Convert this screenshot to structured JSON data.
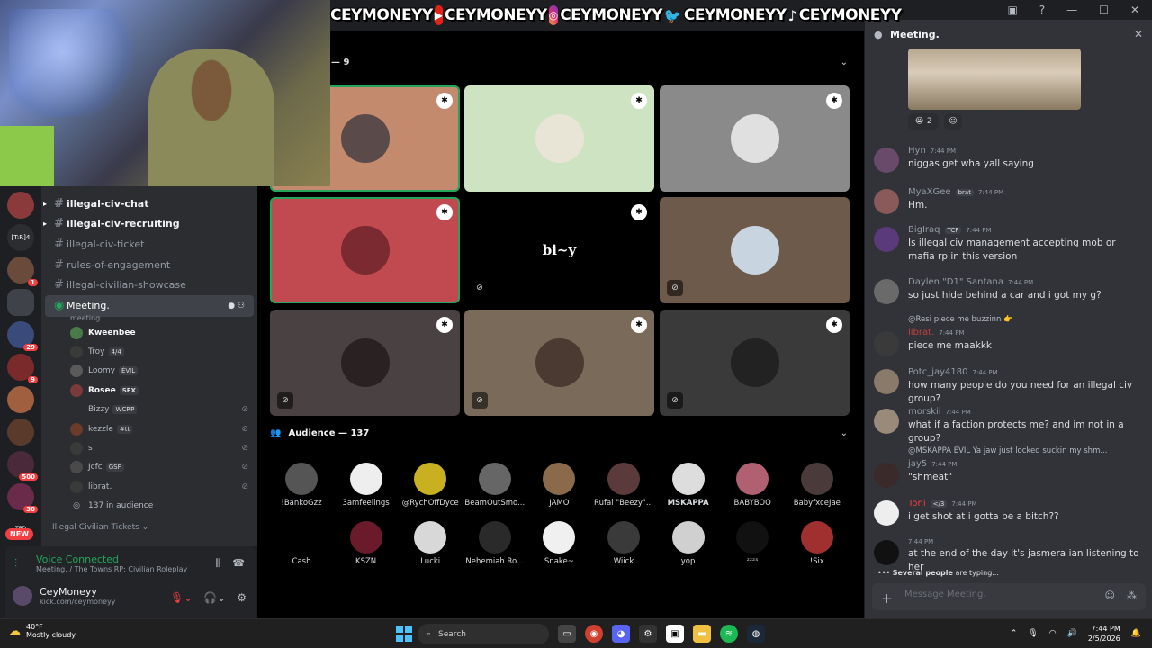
{
  "banner": {
    "handles": [
      "CEYMONEYY",
      "CEYMONEYY",
      "CEYMONEYY",
      "CEYMONEYY",
      "CEYMONEYY"
    ]
  },
  "sidebar": {
    "channels": [
      {
        "label": "illegal-civ-chat",
        "state": "unread"
      },
      {
        "label": "illegal-civ-recruiting",
        "state": "unread"
      },
      {
        "label": "illegal-civ-ticket",
        "state": "normal"
      },
      {
        "label": "rules-of-engagement",
        "state": "normal"
      },
      {
        "label": "illegal-civilian-showcase",
        "state": "normal"
      }
    ],
    "meeting": {
      "label": "Meeting.",
      "sub": "meeting"
    },
    "voice_users": [
      {
        "name": "Kweenbee",
        "tag": ""
      },
      {
        "name": "Troy",
        "tag": "4/4"
      },
      {
        "name": "Loomy",
        "tag": "ÉVIL"
      },
      {
        "name": "Rosee",
        "tag": "SEX"
      },
      {
        "name": "Bizzy",
        "tag": "WCRP"
      },
      {
        "name": "kezzle",
        "tag": "#tt"
      },
      {
        "name": "s",
        "tag": ""
      },
      {
        "name": "Jcfc",
        "tag": "GSF"
      },
      {
        "name": "librat.",
        "tag": ""
      }
    ],
    "audience_count_label": "137 in audience",
    "category": "Illegal Civilian Tickets"
  },
  "rail": {
    "badges": [
      "1",
      "29",
      "9",
      "500",
      "30"
    ],
    "new_label": "NEW"
  },
  "voice_panel": {
    "status": "Voice Connected",
    "sub": "Meeting. / The Towns RP: Civilian Roleplay",
    "username": "CeyMoneyy",
    "user_status": "kick.com/ceymoneyy"
  },
  "stage": {
    "speakers_header": "— 9",
    "audience_header": "Audience — 137",
    "tile_logo": "bi~y",
    "audience": [
      "!BankoGzz",
      "3amfeelings",
      "@RychOffDyce",
      "BeamOutSmo...",
      "JAMO",
      "Rufai \"Beezy\"...",
      "MSKAPPA",
      "BABYBOO",
      "BabyfxceJae",
      "Cash",
      "KSZN",
      "Lucki",
      "Nehemiah Ro...",
      "Snake~",
      "Wiick",
      "yop",
      "ᶻᶻᶻˢ",
      "!Six"
    ]
  },
  "chat": {
    "title": "Meeting.",
    "reaction_count": "2",
    "messages": [
      {
        "name": "Hyn",
        "time": "7:44 PM",
        "tag": "",
        "text": "niggas get wha yall saying",
        "reply": ""
      },
      {
        "name": "MyaXGee",
        "time": "7:44 PM",
        "tag": "brat",
        "text": "Hm.",
        "reply": ""
      },
      {
        "name": "BigIraq",
        "time": "7:44 PM",
        "tag": "TCF",
        "text": "Is illegal civ management accepting mob or mafia rp in this version",
        "reply": ""
      },
      {
        "name": "Daylen \"D1\" Santana",
        "time": "7:44 PM",
        "tag": "",
        "text": "so just hide behind a car and i got my g?",
        "reply": ""
      },
      {
        "name": "librat.",
        "time": "7:44 PM",
        "tag": "",
        "text": "piece me maakkk",
        "reply": "@Resi piece me buzzinn 👉"
      },
      {
        "name": "Potc_jay4180",
        "time": "7:44 PM",
        "tag": "",
        "text": "how many people do you need for an illegal civ group?",
        "reply": ""
      },
      {
        "name": "morskii",
        "time": "7:44 PM",
        "tag": "",
        "text": "what if a faction protects me? and im not in a group?",
        "reply": ""
      },
      {
        "name": "jay5",
        "time": "7:44 PM",
        "tag": "",
        "text": "\"shmeat\"",
        "reply": "@MSKAPPA ÉVIL Ya jaw just locked suckin my shm..."
      },
      {
        "name": "Toni",
        "time": "7:44 PM",
        "tag": "</3",
        "text": "i get shot at i gotta be a bitch??",
        "reply": ""
      },
      {
        "name": "",
        "time": "7:44 PM",
        "tag": "",
        "text": "at the end of the day it's jasmera ian listening to her",
        "reply": ""
      }
    ],
    "typing_bold": "Several people",
    "typing_rest": " are typing...",
    "input_placeholder": "Message Meeting."
  },
  "taskbar": {
    "temp": "40°F",
    "weather": "Mostly cloudy",
    "search": "Search",
    "time": "7:44 PM",
    "date": "2/5/2026"
  },
  "colors": {
    "accent": "#5865f2",
    "green": "#23a55a",
    "red": "#f23f42"
  }
}
